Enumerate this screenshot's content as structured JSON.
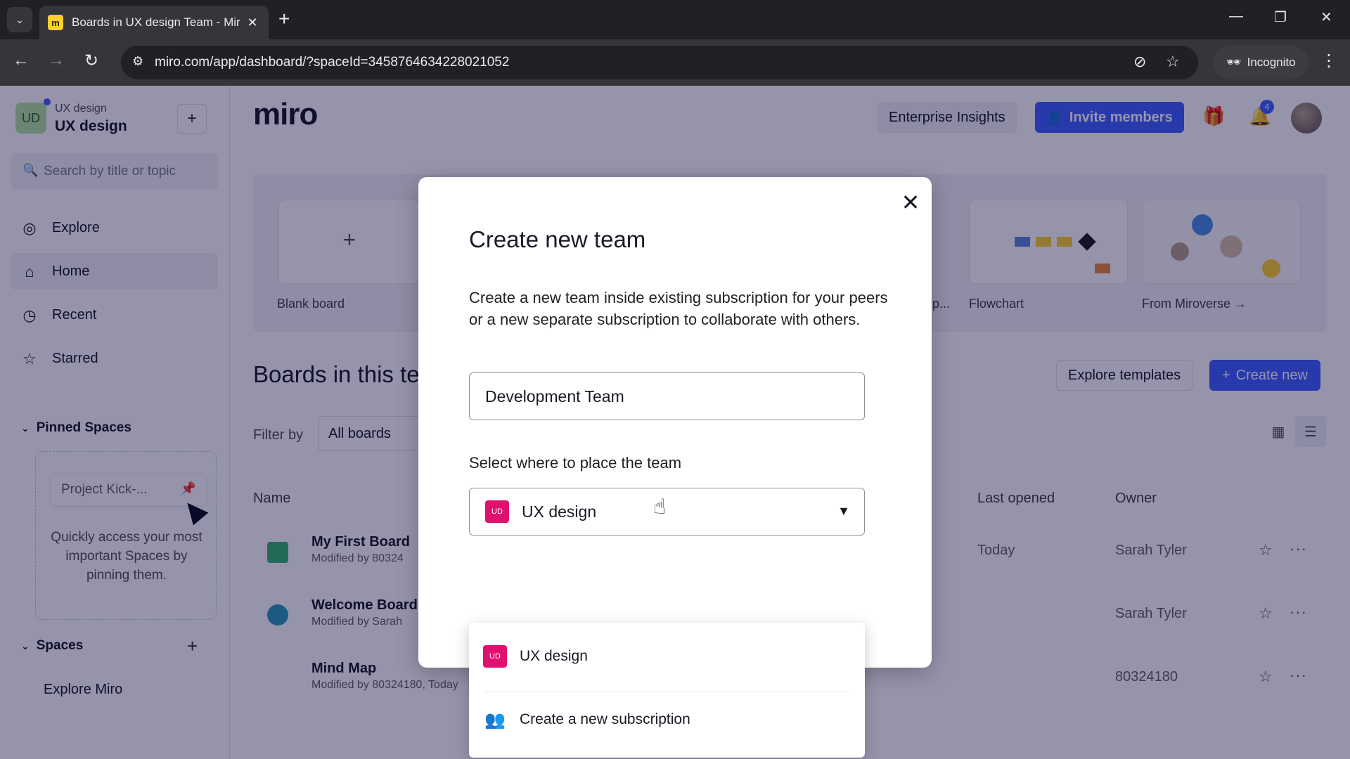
{
  "browser": {
    "tab_title": "Boards in UX design Team - Mir",
    "url": "miro.com/app/dashboard/?spaceId=3458764634228021052",
    "incognito_label": "Incognito"
  },
  "sidebar": {
    "workspace_initials": "UD",
    "workspace_sub": "UX design",
    "workspace_name": "UX design",
    "search_placeholder": "Search by title or topic",
    "nav": [
      {
        "label": "Explore"
      },
      {
        "label": "Home"
      },
      {
        "label": "Recent"
      },
      {
        "label": "Starred"
      }
    ],
    "pinned_title": "Pinned Spaces",
    "pinned_chip": "Project Kick-...",
    "pinned_help": "Quickly access your most important Spaces by pinning them.",
    "spaces_title": "Spaces",
    "spaces_items": [
      "Explore Miro"
    ]
  },
  "header": {
    "logo": "miro",
    "enterprise_insights": "Enterprise Insights",
    "invite_members": "Invite members",
    "notification_count": "4"
  },
  "templates": {
    "blank_board": "Blank board",
    "partial": "p...",
    "flowchart": "Flowchart",
    "miroverse": "From Miroverse →"
  },
  "boards": {
    "title": "Boards in this te",
    "explore_templates": "Explore templates",
    "create_new": "Create new",
    "filter_label": "Filter by",
    "filter_value": "All boards",
    "columns": {
      "name": "Name",
      "last_opened": "Last opened",
      "owner": "Owner"
    },
    "rows": [
      {
        "name": "My First Board",
        "sub": "Modified by 80324",
        "last_opened": "Today",
        "owner": "Sarah Tyler"
      },
      {
        "name": "Welcome Board",
        "sub": "Modified by Sarah",
        "last_opened": "",
        "owner": "Sarah Tyler"
      },
      {
        "name": "Mind Map",
        "sub": "Modified by 80324180, Today",
        "last_opened": "",
        "owner": "80324180"
      }
    ]
  },
  "modal": {
    "title": "Create new team",
    "description": "Create a new team inside existing subscription for your peers or a new separate subscription to collaborate with others.",
    "team_name_value": "Development Team",
    "place_label": "Select where to place the team",
    "selected_option": "UX design",
    "chip_text": "UD",
    "options": [
      {
        "label": "UX design"
      },
      {
        "label": "Create a new subscription"
      }
    ]
  },
  "colors": {
    "accent": "#4262ff",
    "chip": "#e0106e",
    "overlay": "#050038"
  }
}
